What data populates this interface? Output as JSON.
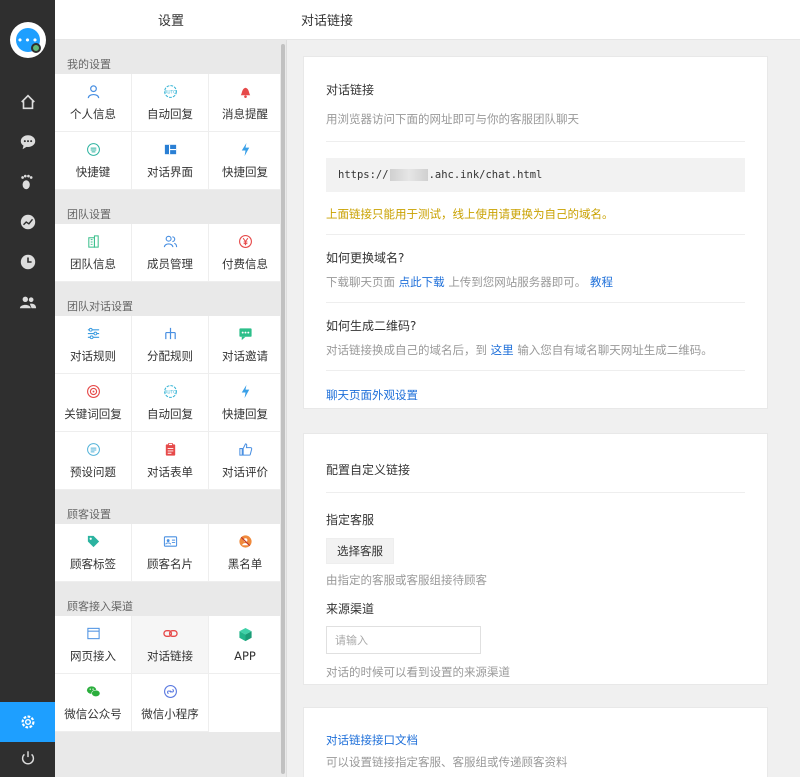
{
  "settings": {
    "title": "设置",
    "groups": [
      {
        "title": "我的设置",
        "items": [
          {
            "label": "个人信息",
            "icon": "user-icon"
          },
          {
            "label": "自动回复",
            "icon": "auto-icon"
          },
          {
            "label": "消息提醒",
            "icon": "bell-icon"
          },
          {
            "label": "快捷键",
            "icon": "keyboard-icon"
          },
          {
            "label": "对话界面",
            "icon": "layout-icon"
          },
          {
            "label": "快捷回复",
            "icon": "bolt-icon"
          }
        ]
      },
      {
        "title": "团队设置",
        "items": [
          {
            "label": "团队信息",
            "icon": "building-icon"
          },
          {
            "label": "成员管理",
            "icon": "members-icon"
          },
          {
            "label": "付费信息",
            "icon": "yen-icon"
          }
        ]
      },
      {
        "title": "团队对话设置",
        "items": [
          {
            "label": "对话规则",
            "icon": "rules-icon"
          },
          {
            "label": "分配规则",
            "icon": "distribute-icon"
          },
          {
            "label": "对话邀请",
            "icon": "invite-icon"
          },
          {
            "label": "关键词回复",
            "icon": "target-icon"
          },
          {
            "label": "自动回复",
            "icon": "auto-icon"
          },
          {
            "label": "快捷回复",
            "icon": "bolt-icon"
          },
          {
            "label": "预设问题",
            "icon": "question-icon"
          },
          {
            "label": "对话表单",
            "icon": "form-icon"
          },
          {
            "label": "对话评价",
            "icon": "thumb-icon"
          }
        ]
      },
      {
        "title": "顾客设置",
        "items": [
          {
            "label": "顾客标签",
            "icon": "tag-icon"
          },
          {
            "label": "顾客名片",
            "icon": "card-icon"
          },
          {
            "label": "黑名单",
            "icon": "block-icon"
          }
        ]
      },
      {
        "title": "顾客接入渠道",
        "items": [
          {
            "label": "网页接入",
            "icon": "webpage-icon"
          },
          {
            "label": "对话链接",
            "icon": "link-icon"
          },
          {
            "label": "APP",
            "icon": "cube-icon"
          },
          {
            "label": "微信公众号",
            "icon": "wechat-icon"
          },
          {
            "label": "微信小程序",
            "icon": "miniprogram-icon"
          }
        ]
      }
    ]
  },
  "main": {
    "title": "对话链接",
    "card1": {
      "title": "对话链接",
      "desc": "用浏览器访问下面的网址即可与你的客服团队聊天",
      "url_prefix": "https://",
      "url_suffix": ".ahc.ink/chat.html",
      "warning": "上面链接只能用于测试，线上使用请更换为自己的域名。",
      "q1_title": "如何更换域名?",
      "q1_text_a": "下载聊天页面",
      "q1_link1": "点此下载",
      "q1_text_b": "上传到您网站服务器即可。",
      "q1_link2": "教程",
      "q2_title": "如何生成二维码?",
      "q2_text_a": "对话链接换成自己的域名后，到",
      "q2_link": "这里",
      "q2_text_b": "输入您自有域名聊天网址生成二维码。",
      "appearance_link": "聊天页面外观设置"
    },
    "card2": {
      "title": "配置自定义链接",
      "agent_label": "指定客服",
      "agent_button": "选择客服",
      "agent_hint": "由指定的客服或客服组接待顾客",
      "source_label": "来源渠道",
      "source_placeholder": "请输入",
      "source_hint": "对话的时候可以看到设置的来源渠道"
    },
    "card3": {
      "link": "对话链接接口文档",
      "hint": "可以设置链接指定客服、客服组或传递顾客资料"
    }
  },
  "colors": {
    "accent": "#1e9fff",
    "rail": "#2f2f2f",
    "warning": "#c9a100",
    "link": "#1e6fd9"
  }
}
